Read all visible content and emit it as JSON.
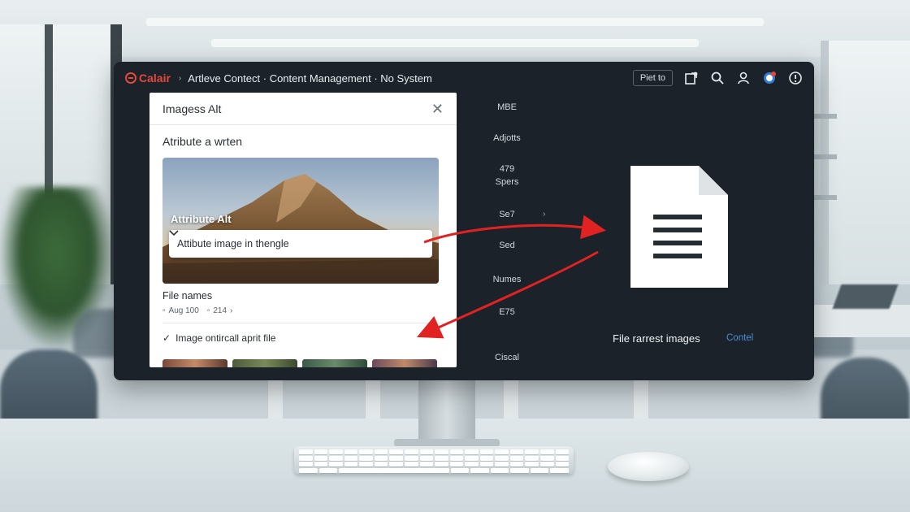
{
  "topbar": {
    "brand": "Calair",
    "breadcrumb": "Artleve Contect · Content Management · No System",
    "button_label": "Piet to"
  },
  "dialog": {
    "title": "Imagess Alt",
    "subtitle": "Atribute a wrten",
    "hero_label": "Attribute Alt",
    "hero_select_value": "Attibute image in thengle",
    "file_names_label": "File names",
    "meta": [
      "Aug 100",
      "214"
    ],
    "check_label": "Image ontircall aprit file"
  },
  "middle_list": [
    "MBE",
    "Adjotts",
    "479\nSpers",
    "Se7",
    "Sed",
    "Numes",
    "E75",
    "Ciscal"
  ],
  "document_panel": {
    "caption": "File rarrest images",
    "link": "Contel"
  },
  "colors": {
    "brand": "#e5483a",
    "arrow": "#e02222",
    "link": "#4a8fd6",
    "screen_bg": "#1b2229"
  },
  "icons": [
    "share-icon",
    "search-icon",
    "user-icon",
    "notification-icon",
    "info-icon",
    "close-icon",
    "chevron-down-icon",
    "document-icon"
  ]
}
